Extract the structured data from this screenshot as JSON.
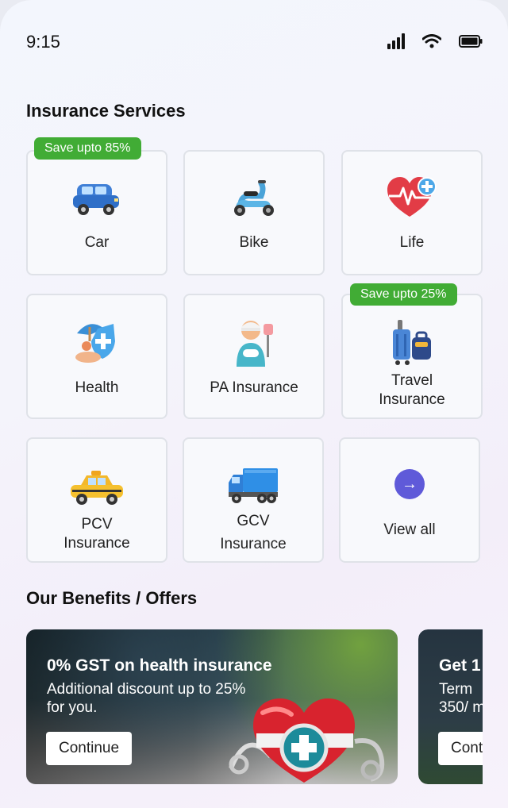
{
  "status": {
    "time": "9:15"
  },
  "insurance": {
    "title": "Insurance Services",
    "tiles": [
      {
        "label": "Car",
        "badge": "Save upto 85%"
      },
      {
        "label": "Bike"
      },
      {
        "label": "Life"
      },
      {
        "label": "Health"
      },
      {
        "label": "PA Insurance"
      },
      {
        "label_line1": "Travel",
        "label_line2": "Insurance",
        "badge": "Save upto 25%"
      },
      {
        "label_line1": "PCV",
        "label_line2": "Insurance"
      },
      {
        "label_line1": "GCV",
        "label_line2": "Insurance"
      },
      {
        "label": "View all",
        "icon": "→"
      }
    ]
  },
  "benefits": {
    "title": "Our Benefits / Offers",
    "offers": [
      {
        "title": "0% GST on health insurance",
        "subtitle_line1": "Additional discount up to 25%",
        "subtitle_line2": "for you.",
        "button": "Continue"
      },
      {
        "title": "Get 1",
        "subtitle_line1": "Term",
        "subtitle_line2": "350/ m",
        "button": "Continue"
      }
    ]
  },
  "colors": {
    "badge": "#41ac35",
    "accent": "#5f5ad9"
  }
}
